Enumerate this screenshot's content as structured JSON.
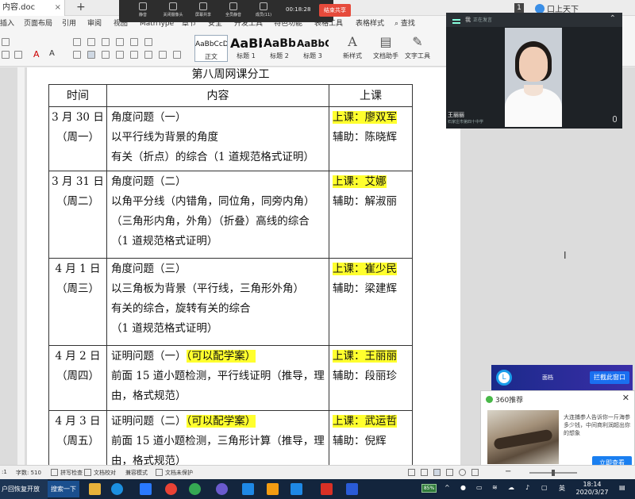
{
  "titlebar": {
    "doc_tab": "内容.doc",
    "badge": "1",
    "user": "口上天下"
  },
  "meeting_bar": {
    "items": [
      "静音",
      "关闭摄像头",
      "屏幕共享",
      "全员静音",
      "成员(11)"
    ],
    "timer": "00:18:28",
    "end_label": "结束共享"
  },
  "menu": {
    "items": [
      "插入",
      "页面布局",
      "引用",
      "审阅",
      "视图",
      "MathType",
      "章节",
      "安全",
      "开发工具",
      "特色功能",
      "表格工具",
      "表格样式"
    ],
    "search": "查找"
  },
  "ribbon": {
    "styles": [
      {
        "sample": "AaBbCcDd",
        "label": "正文"
      },
      {
        "sample": "AaBb",
        "label": "标题 1"
      },
      {
        "sample": "AaBb(",
        "label": "标题 2"
      },
      {
        "sample": "AaBbC(",
        "label": "标题 3"
      }
    ],
    "new_style": "新样式",
    "doc_helper": "文档助手",
    "text_tool": "文字工具"
  },
  "document": {
    "table_title": "第八周网课分工",
    "headers": [
      "时间",
      "内容",
      "上课"
    ],
    "rows": [
      {
        "date": "3 月 30 日",
        "weekday": "（周一）",
        "content_title": "角度问题（一）",
        "content_title_note": "",
        "content_lines": [
          "以平行线为背景的角度",
          "有关（折点）的综合（1 道规范格式证明）"
        ],
        "teacher_label": "上课：廖双军",
        "assistant_label": "辅助：陈晓辉"
      },
      {
        "date": "3 月 31 日",
        "weekday": "（周二）",
        "content_title": "角度问题（二）",
        "content_title_note": "",
        "content_lines": [
          "以角平分线（内错角，同位角，同旁内角）",
          "（三角形内角，外角）（折叠）高线的综合",
          "（1 道规范格式证明）"
        ],
        "teacher_label": "上课：艾娜",
        "assistant_label": "辅助：解淑丽"
      },
      {
        "date": "4 月 1 日",
        "weekday": "（周三）",
        "content_title": "角度问题（三）",
        "content_title_note": "",
        "content_lines": [
          "以三角板为背景（平行线，三角形外角）",
          "有关的综合，旋转有关的综合",
          "（1 道规范格式证明）"
        ],
        "teacher_label": "上课：崔少民",
        "assistant_label": "辅助：梁建辉"
      },
      {
        "date": "4 月 2 日",
        "weekday": "（周四）",
        "content_title": "证明问题（一）",
        "content_title_note": "（可以配学案）",
        "content_lines": [
          "前面 15 道小题检测，平行线证明（推导，理",
          "由，格式规范）"
        ],
        "teacher_label": "上课：王丽丽",
        "assistant_label": "辅助：段丽珍"
      },
      {
        "date": "4 月 3 日",
        "weekday": "（周五）",
        "content_title": "证明问题（二）",
        "content_title_note": "（可以配学案）",
        "content_lines": [
          "前面 15 道小题检测，三角形计算（推导，理",
          "由，格式规范）"
        ],
        "teacher_label": "上课：武运哲",
        "assistant_label": "辅助：倪辉"
      }
    ]
  },
  "video": {
    "me_label": "我",
    "speaking": "正在发言",
    "name": "王丽丽",
    "school": "石家庄市第四十中学"
  },
  "banner": {
    "label": "面档",
    "button": "拦截此窗口"
  },
  "popup": {
    "title": "360推荐",
    "text": "大连捕参人告诉你一斤海参多少钱，中间商利润超出你的想象",
    "cta": "立即查看"
  },
  "statusbar": {
    "page": ":1",
    "words": "字数: 510",
    "spell": "拼写检查",
    "proof": "文档校对",
    "compat": "兼容模式",
    "unprotected": "文档未保护"
  },
  "taskbar": {
    "left_app": "户回恢复开放",
    "search": "搜索一下",
    "battery": "85%",
    "ime": "英",
    "time": "18:14",
    "date": "2020/3/27"
  },
  "colors": {
    "highlight": "#ffff2e",
    "end_button": "#e64a3b",
    "taskbar": "#13253d"
  }
}
